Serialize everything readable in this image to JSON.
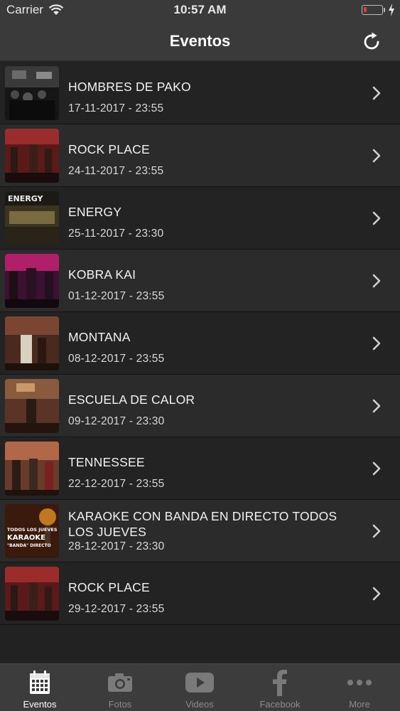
{
  "status": {
    "carrier": "Carrier",
    "time": "10:57 AM"
  },
  "nav": {
    "title": "Eventos"
  },
  "events": [
    {
      "title": "HOMBRES DE PAKO",
      "date": "17-11-2017 - 23:55"
    },
    {
      "title": "ROCK PLACE",
      "date": "24-11-2017 - 23:55"
    },
    {
      "title": "ENERGY",
      "date": "25-11-2017 - 23:30"
    },
    {
      "title": "KOBRA KAI",
      "date": "01-12-2017 - 23:55"
    },
    {
      "title": "MONTANA",
      "date": "08-12-2017 - 23:55"
    },
    {
      "title": "ESCUELA DE CALOR",
      "date": "09-12-2017 - 23:30"
    },
    {
      "title": "TENNESSEE",
      "date": "22-12-2017 - 23:55"
    },
    {
      "title": "KARAOKE CON BANDA EN DIRECTO TODOS LOS JUEVES",
      "date": "28-12-2017 - 23:30"
    },
    {
      "title": "ROCK PLACE",
      "date": "29-12-2017 - 23:55"
    }
  ],
  "thumb_text": {
    "energy": "ENERGY",
    "karaoke_1": "TODOS LOS JUEVES",
    "karaoke_2": "KARAOKE",
    "karaoke_3": "\"BANDA\" DIRECTO"
  },
  "tabs": [
    {
      "label": "Eventos",
      "icon": "calendar-icon",
      "active": true
    },
    {
      "label": "Fotos",
      "icon": "camera-icon",
      "active": false
    },
    {
      "label": "Videos",
      "icon": "youtube-icon",
      "active": false
    },
    {
      "label": "Facebook",
      "icon": "facebook-icon",
      "active": false
    },
    {
      "label": "More",
      "icon": "more-dots-icon",
      "active": false
    }
  ],
  "colors": {
    "bar": "#3a3a3a",
    "row_dark": "#232323",
    "row_light": "#2b2b2b",
    "active_tab": "#ffffff",
    "inactive_tab": "#8c8c8c",
    "battery_low": "#e23b3b"
  }
}
